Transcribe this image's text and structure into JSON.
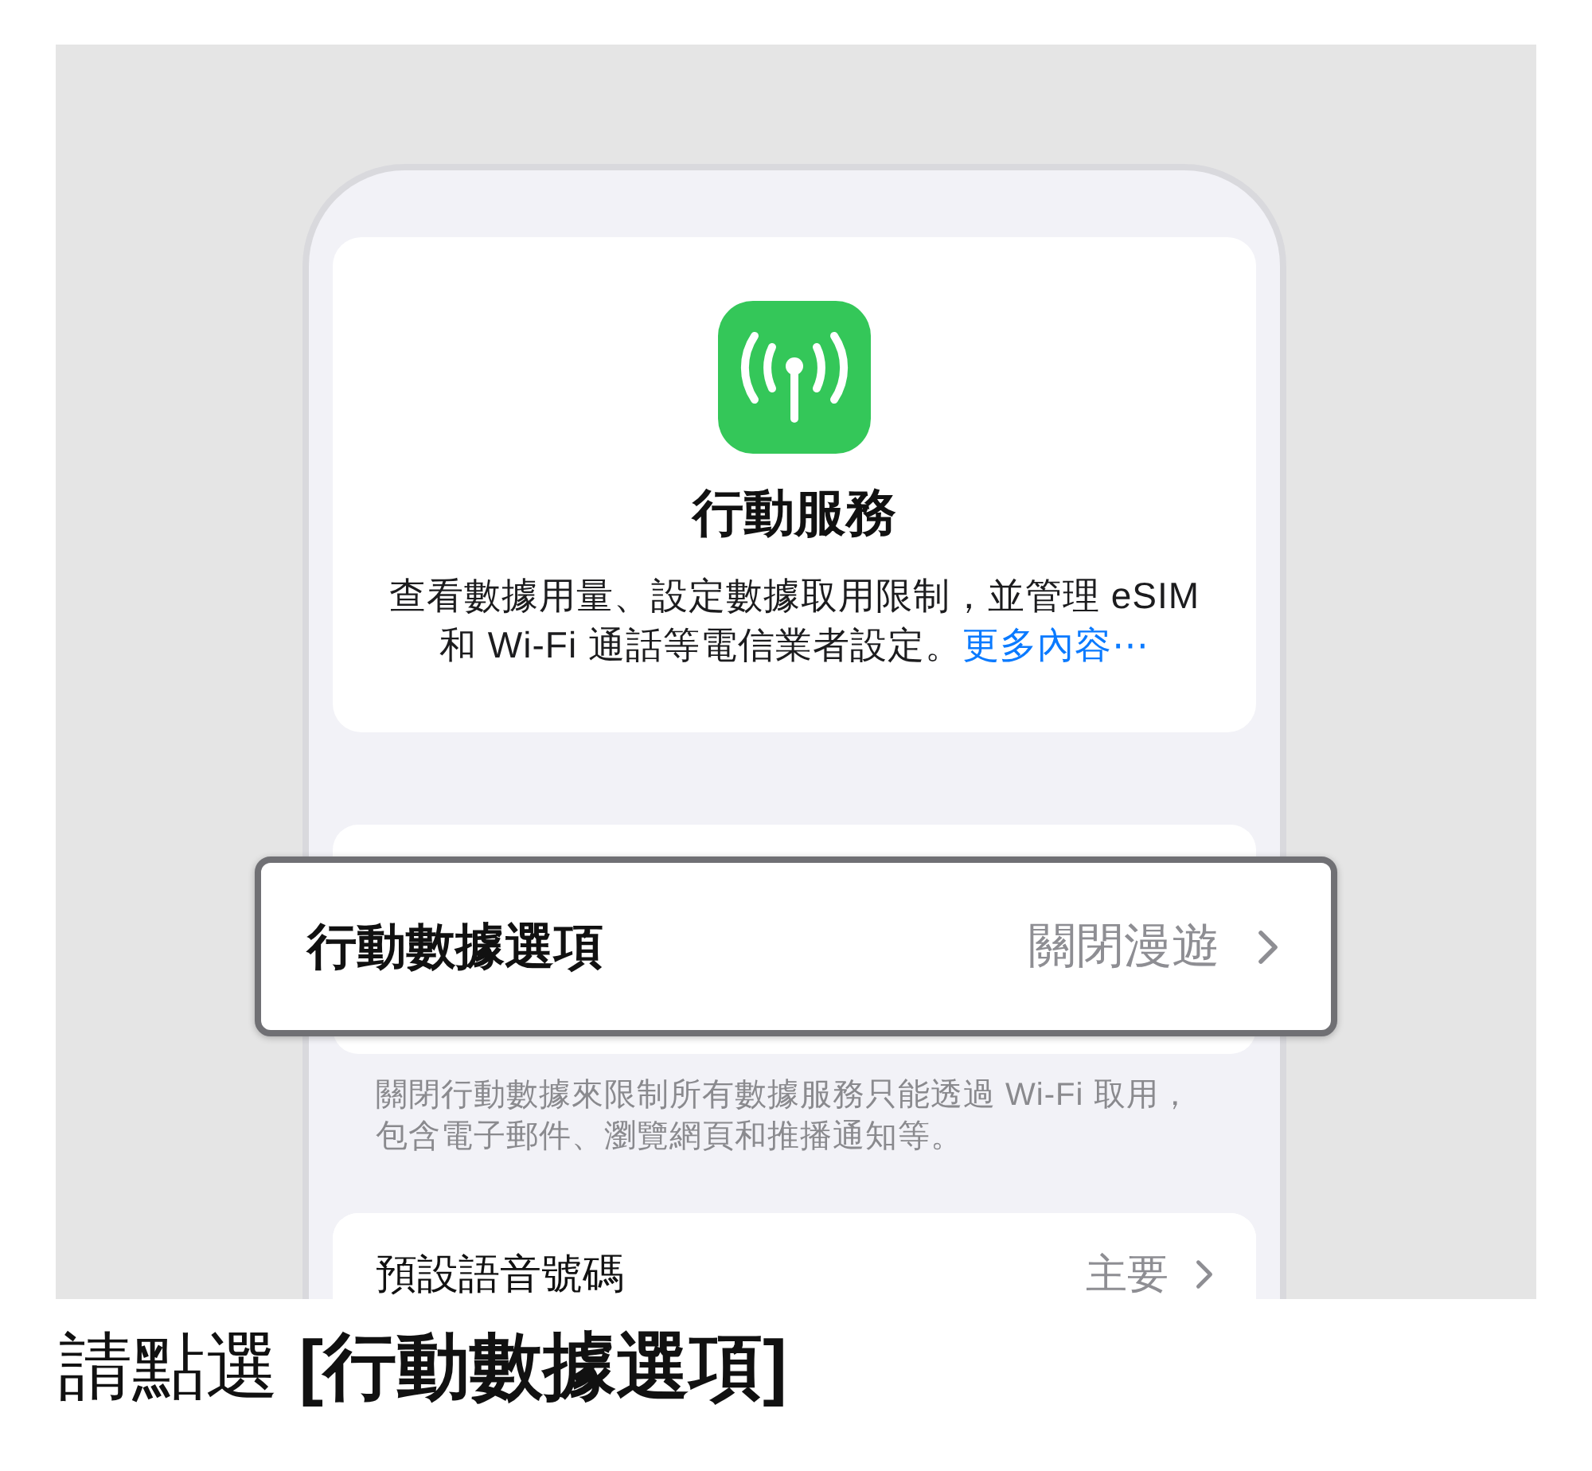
{
  "service_card": {
    "title": "行動服務",
    "description": "查看數據用量、設定數據取用限制，並管理 eSIM 和 Wi-Fi 通話等電信業者設定。",
    "link": "更多內容⋯"
  },
  "cellular_data_options": {
    "label": "行動數據選項",
    "value": "關閉漫遊",
    "highlighted": true
  },
  "footnote": "關閉行動數據來限制所有數據服務只能透過 Wi-Fi 取用，包含電子郵件、瀏覽網頁和推播通知等。",
  "default_voice_line": {
    "label": "預設語音號碼",
    "value": "主要"
  },
  "instruction": "請點選 **[行動數據選項]**"
}
